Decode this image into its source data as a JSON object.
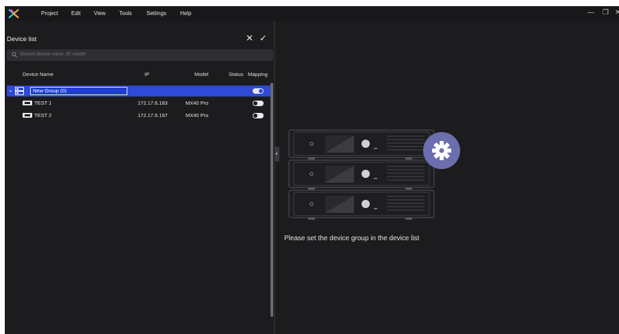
{
  "menubar": {
    "items": [
      "Project",
      "Edit",
      "View",
      "Tools",
      "Settings",
      "Help"
    ],
    "minimize_glyph": "—",
    "restore_glyph": "❐",
    "close_glyph": "✕"
  },
  "device_list": {
    "title": "Device list",
    "cancel_glyph": "✕",
    "confirm_glyph": "✓",
    "search_placeholder": "Search device name, IP, model",
    "columns": [
      "Device Name",
      "IP",
      "Model",
      "Status",
      "Mapping"
    ],
    "group": {
      "name": "New Group (0)",
      "expanded_glyph": "⌄",
      "mapping_on": true
    },
    "devices": [
      {
        "name": "TEST 1",
        "ip": "172.17.6.183",
        "model": "MX40 Pro",
        "mapping_on": false
      },
      {
        "name": "TEST 2",
        "ip": "172.17.6.197",
        "model": "MX40 Pro",
        "mapping_on": false
      }
    ]
  },
  "empty_state": {
    "message": "Please set the device group in the device list",
    "icon": "device-stack-with-gear-icon"
  },
  "colors": {
    "accent": "#2f4ad6",
    "background": "#1c1c1e",
    "toggle_on": "#3a5bf0",
    "gear_circle": "#6b6fb0"
  }
}
